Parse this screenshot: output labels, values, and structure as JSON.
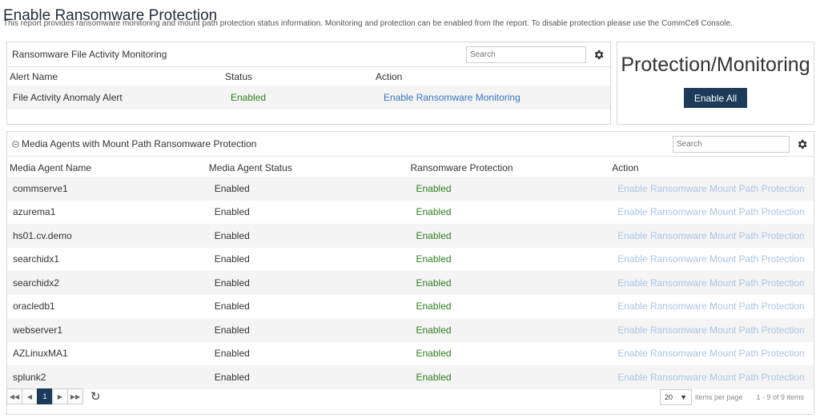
{
  "page": {
    "title": "Enable Ransomware Protection",
    "description": "This report provides ransomware monitoring and mount path protection status information. Monitoring and protection can be enabled from the report. To disable protection please use the CommCell Console."
  },
  "alerts_panel": {
    "title": "Ransomware File Activity Monitoring",
    "search_placeholder": "Search",
    "columns": [
      "Alert Name",
      "Status",
      "Action"
    ],
    "rows": [
      {
        "name": "File Activity Anomaly Alert",
        "status": "Enabled",
        "action": "Enable Ransomware Monitoring"
      }
    ]
  },
  "protection_panel": {
    "title": "Protection/Monitoring",
    "button_label": "Enable All"
  },
  "media_panel": {
    "title": "Media Agents with Mount Path Ransomware Protection",
    "search_placeholder": "Search",
    "columns": [
      "Media Agent Name",
      "Media Agent Status",
      "Ransomware Protection",
      "Action"
    ],
    "rows": [
      {
        "name": "commserve1",
        "status": "Enabled",
        "protection": "Enabled",
        "action": "Enable Ransomware Mount Path Protection"
      },
      {
        "name": "azurema1",
        "status": "Enabled",
        "protection": "Enabled",
        "action": "Enable Ransomware Mount Path Protection"
      },
      {
        "name": "hs01.cv.demo",
        "status": "Enabled",
        "protection": "Enabled",
        "action": "Enable Ransomware Mount Path Protection"
      },
      {
        "name": "searchidx1",
        "status": "Enabled",
        "protection": "Enabled",
        "action": "Enable Ransomware Mount Path Protection"
      },
      {
        "name": "searchidx2",
        "status": "Enabled",
        "protection": "Enabled",
        "action": "Enable Ransomware Mount Path Protection"
      },
      {
        "name": "oracledb1",
        "status": "Enabled",
        "protection": "Enabled",
        "action": "Enable Ransomware Mount Path Protection"
      },
      {
        "name": "webserver1",
        "status": "Enabled",
        "protection": "Enabled",
        "action": "Enable Ransomware Mount Path Protection"
      },
      {
        "name": "AZLinuxMA1",
        "status": "Enabled",
        "protection": "Enabled",
        "action": "Enable Ransomware Mount Path Protection"
      },
      {
        "name": "splunk2",
        "status": "Enabled",
        "protection": "Enabled",
        "action": "Enable Ransomware Mount Path Protection"
      }
    ]
  },
  "pagination": {
    "current_page": "1",
    "per_page": "20",
    "per_page_label": "items per page",
    "range_text": "1 - 9 of 9 items"
  },
  "colors": {
    "enabled_text": "#2e7d1c",
    "link": "#3a74c2",
    "link_disabled": "#a9c4e6",
    "primary_button": "#1c3b5a"
  },
  "icons": [
    "gear-icon",
    "collapse-icon",
    "first-page-icon",
    "prev-page-icon",
    "next-page-icon",
    "last-page-icon",
    "refresh-icon",
    "dropdown-caret-icon"
  ]
}
